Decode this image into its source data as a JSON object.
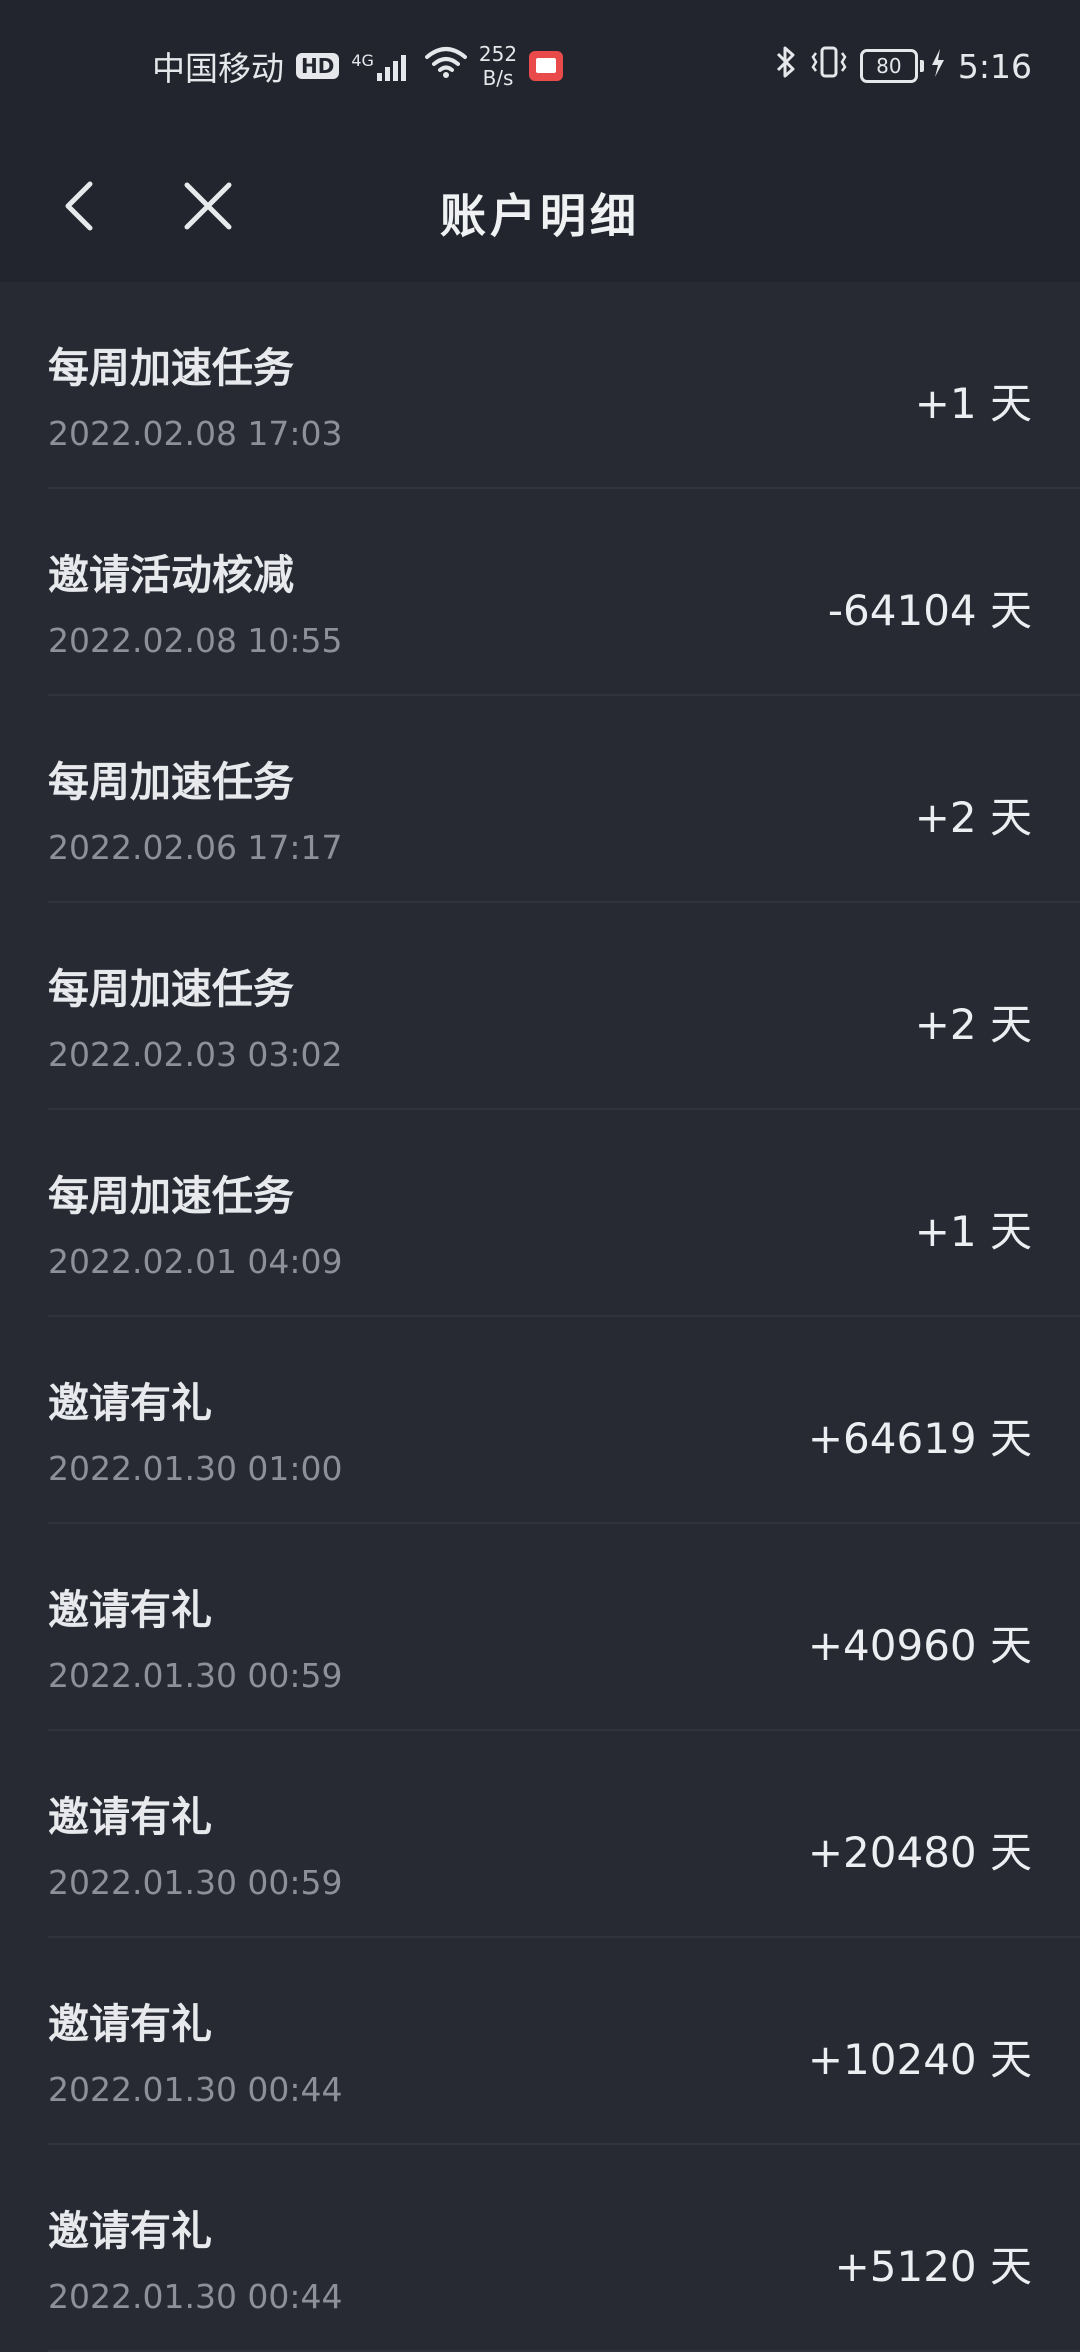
{
  "status_bar": {
    "carrier": "中国移动",
    "hd": "HD",
    "signal": "4G",
    "net_speed_value": "252",
    "net_speed_unit": "B/s",
    "battery": "80",
    "time": "5:16"
  },
  "header": {
    "title": "账户明细"
  },
  "records": [
    {
      "title": "每周加速任务",
      "time": "2022.02.08 17:03",
      "amount": "+1 天"
    },
    {
      "title": "邀请活动核减",
      "time": "2022.02.08 10:55",
      "amount": "-64104 天"
    },
    {
      "title": "每周加速任务",
      "time": "2022.02.06 17:17",
      "amount": "+2 天"
    },
    {
      "title": "每周加速任务",
      "time": "2022.02.03 03:02",
      "amount": "+2 天"
    },
    {
      "title": "每周加速任务",
      "time": "2022.02.01 04:09",
      "amount": "+1 天"
    },
    {
      "title": "邀请有礼",
      "time": "2022.01.30 01:00",
      "amount": "+64619 天"
    },
    {
      "title": "邀请有礼",
      "time": "2022.01.30 00:59",
      "amount": "+40960 天"
    },
    {
      "title": "邀请有礼",
      "time": "2022.01.30 00:59",
      "amount": "+20480 天"
    },
    {
      "title": "邀请有礼",
      "time": "2022.01.30 00:44",
      "amount": "+10240 天"
    },
    {
      "title": "邀请有礼",
      "time": "2022.01.30 00:44",
      "amount": "+5120 天"
    }
  ]
}
